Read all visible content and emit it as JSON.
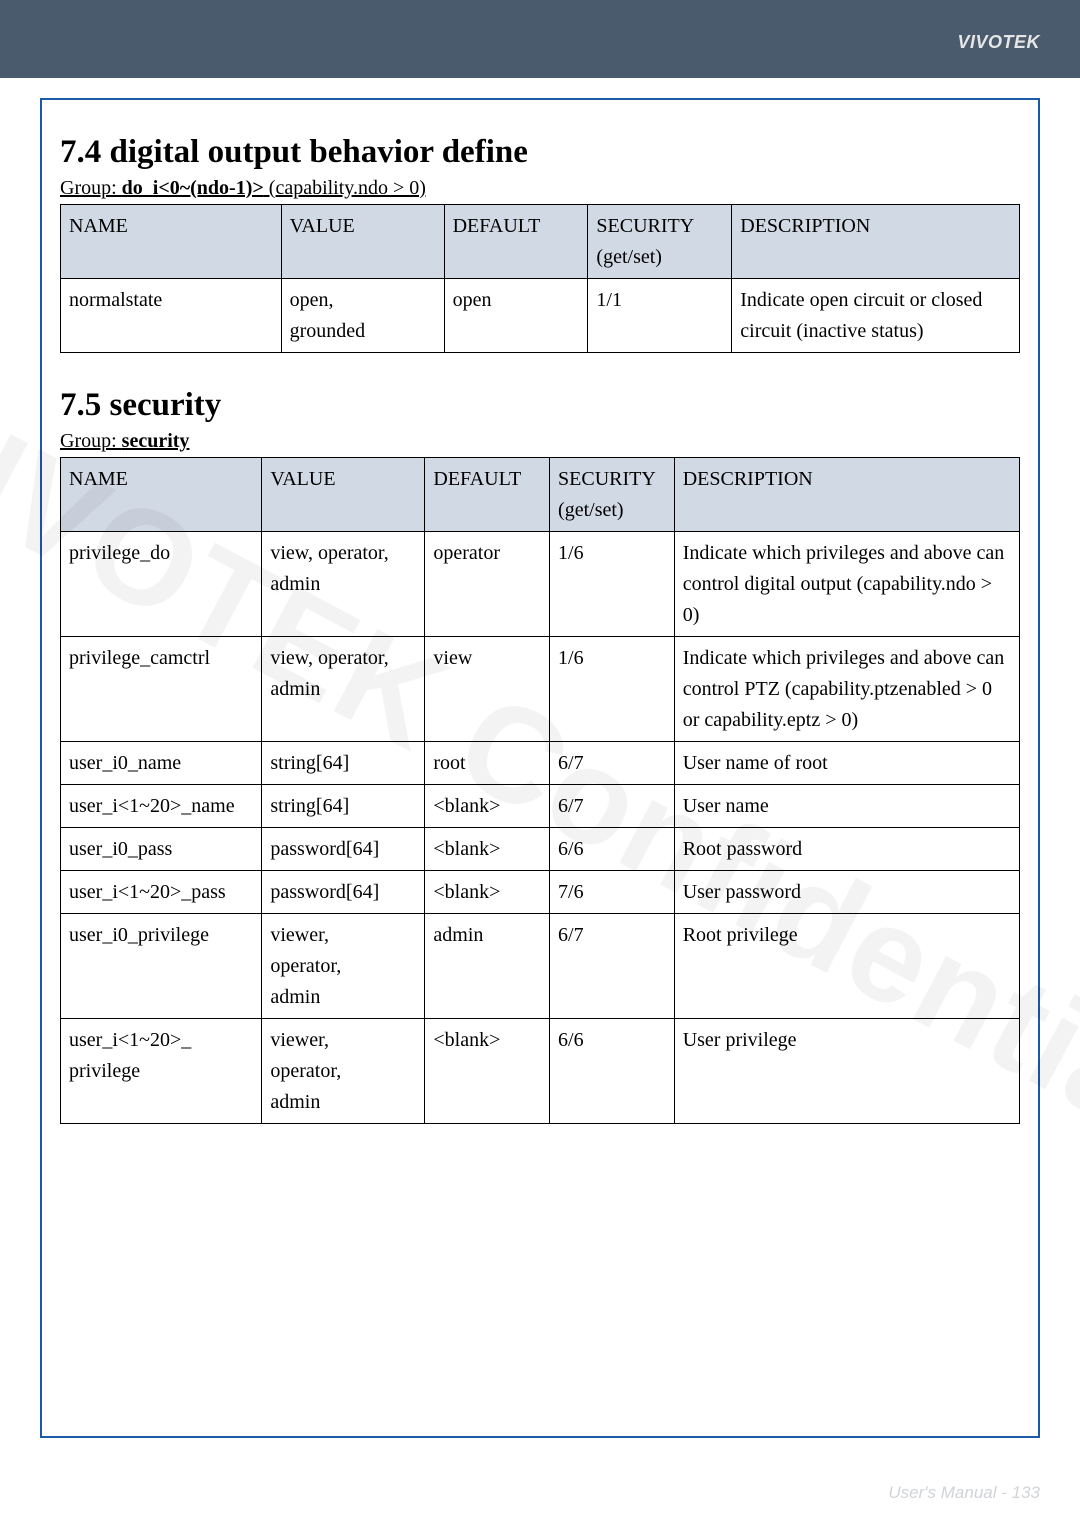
{
  "brand": "VIVOTEK",
  "watermark": "VIVOTEK Confidential",
  "footer": "User's Manual - 133",
  "section1": {
    "heading": "7.4 digital output behavior define",
    "group_prefix": "Group: ",
    "group_bold": "do_i<0~(ndo-1)>",
    "group_suffix": " (capability.ndo > 0)",
    "headers": {
      "name": "NAME",
      "value": "VALUE",
      "default": "DEFAULT",
      "security": "SECURITY",
      "security_sub": "(get/set)",
      "description": "DESCRIPTION"
    },
    "rows": [
      {
        "name": "normalstate",
        "value": "open,\ngrounded",
        "default": "open",
        "security": "1/1",
        "description": "Indicate open circuit or closed circuit (inactive status)"
      }
    ]
  },
  "section2": {
    "heading": "7.5 security",
    "group_prefix": "Group: ",
    "group_bold": "security",
    "headers": {
      "name": "NAME",
      "value": "VALUE",
      "default": "DEFAULT",
      "security": "SECURITY",
      "security_sub": "(get/set)",
      "description": "DESCRIPTION"
    },
    "rows": [
      {
        "name": "privilege_do",
        "value": "view, operator, admin",
        "default": "operator",
        "security": "1/6",
        "description": "Indicate which privileges and above can control digital output (capability.ndo > 0)"
      },
      {
        "name": "privilege_camctrl",
        "value": "view, operator, admin",
        "default": "view",
        "security": "1/6",
        "description": "Indicate which privileges and above can control PTZ (capability.ptzenabled > 0 or capability.eptz > 0)"
      },
      {
        "name": "user_i0_name",
        "value": "string[64]",
        "default": "root",
        "security": "6/7",
        "description": "User name of root"
      },
      {
        "name": "user_i<1~20>_name",
        "value": "string[64]",
        "default": "<blank>",
        "security": "6/7",
        "description": "User name"
      },
      {
        "name": "user_i0_pass",
        "value": "password[64]",
        "default": "<blank>",
        "security": "6/6",
        "description": "Root password"
      },
      {
        "name": "user_i<1~20>_pass",
        "value": "password[64]",
        "default": "<blank>",
        "security": "7/6",
        "description": "User password"
      },
      {
        "name": "user_i0_privilege",
        "value": "viewer,\noperator,\nadmin",
        "default": "admin",
        "security": "6/7",
        "description": "Root privilege"
      },
      {
        "name": "user_i<1~20>_\nprivilege",
        "value": "viewer,\noperator,\nadmin",
        "default": "<blank>",
        "security": "6/6",
        "description": "User privilege"
      }
    ]
  },
  "chart_data": [
    {
      "type": "table",
      "title": "7.4 digital output behavior define — Group: do_i<0~(ndo-1)> (capability.ndo > 0)",
      "columns": [
        "NAME",
        "VALUE",
        "DEFAULT",
        "SECURITY (get/set)",
        "DESCRIPTION"
      ],
      "rows": [
        [
          "normalstate",
          "open, grounded",
          "open",
          "1/1",
          "Indicate open circuit or closed circuit (inactive status)"
        ]
      ]
    },
    {
      "type": "table",
      "title": "7.5 security — Group: security",
      "columns": [
        "NAME",
        "VALUE",
        "DEFAULT",
        "SECURITY (get/set)",
        "DESCRIPTION"
      ],
      "rows": [
        [
          "privilege_do",
          "view, operator, admin",
          "operator",
          "1/6",
          "Indicate which privileges and above can control digital output (capability.ndo > 0)"
        ],
        [
          "privilege_camctrl",
          "view, operator, admin",
          "view",
          "1/6",
          "Indicate which privileges and above can control PTZ (capability.ptzenabled > 0 or capability.eptz > 0)"
        ],
        [
          "user_i0_name",
          "string[64]",
          "root",
          "6/7",
          "User name of root"
        ],
        [
          "user_i<1~20>_name",
          "string[64]",
          "<blank>",
          "6/7",
          "User name"
        ],
        [
          "user_i0_pass",
          "password[64]",
          "<blank>",
          "6/6",
          "Root password"
        ],
        [
          "user_i<1~20>_pass",
          "password[64]",
          "<blank>",
          "7/6",
          "User password"
        ],
        [
          "user_i0_privilege",
          "viewer, operator, admin",
          "admin",
          "6/7",
          "Root privilege"
        ],
        [
          "user_i<1~20>_privilege",
          "viewer, operator, admin",
          "<blank>",
          "6/6",
          "User privilege"
        ]
      ]
    }
  ]
}
